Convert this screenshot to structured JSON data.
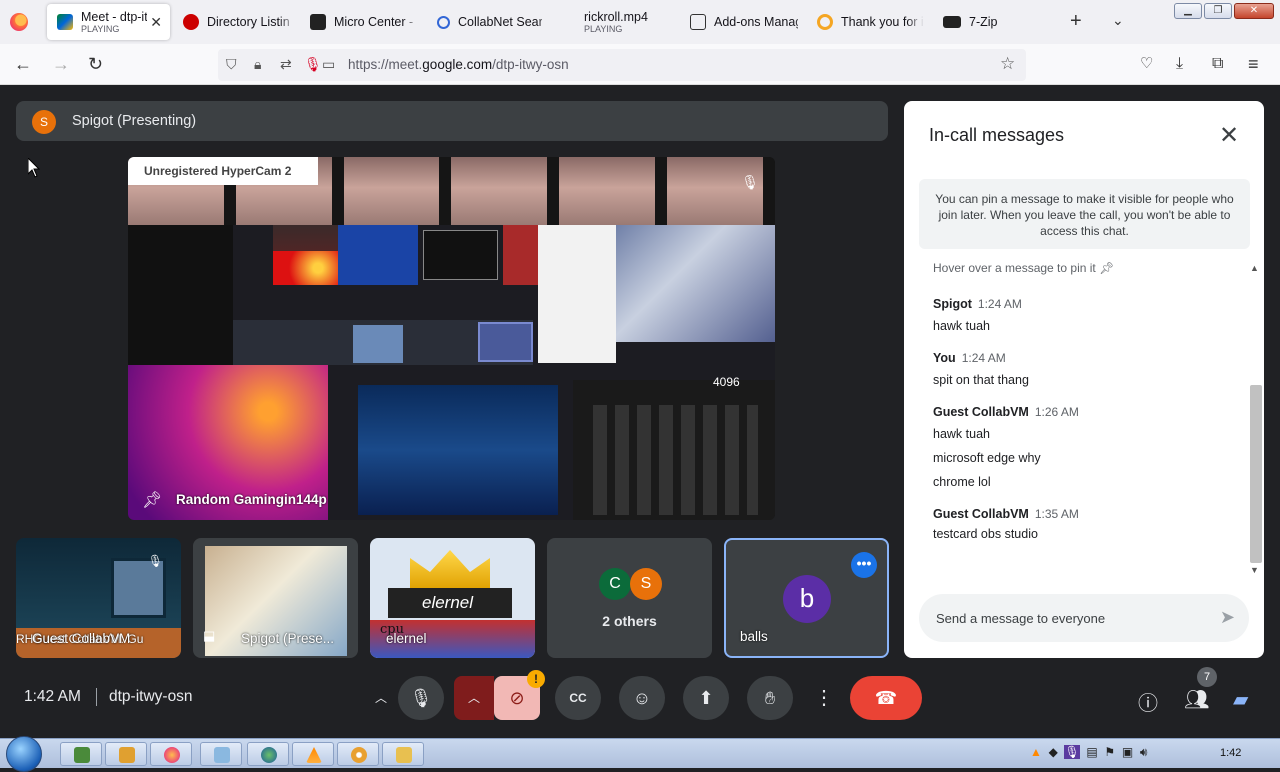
{
  "browser": {
    "tabs": [
      {
        "title": "Meet - dtp-itwy-osn",
        "status": "PLAYING",
        "active": true
      },
      {
        "title": "Directory Listing"
      },
      {
        "title": "Micro Center - I"
      },
      {
        "title": "CollabNet Search"
      },
      {
        "title": "rickroll.mp4",
        "status": "PLAYING"
      },
      {
        "title": "Add-ons Manager"
      },
      {
        "title": "Thank you for i"
      },
      {
        "title": "7-Zip"
      }
    ],
    "url_prefix": "https://meet.",
    "url_domain": "google.com",
    "url_path": "/dtp-itwy-osn"
  },
  "meet": {
    "presenter": {
      "initial": "S",
      "label": "Spigot (Presenting)"
    },
    "main_video": {
      "overlay_label": "Unregistered HyperCam 2",
      "name": "Random Gamingin144p",
      "counter": "4096"
    },
    "participants": [
      {
        "name": "Guest CollabVM",
        "overlay": "RHGuest CollabVM: Gu"
      },
      {
        "name": "Spigot (Prese..."
      },
      {
        "name": "elernel",
        "banner": "elernel",
        "sticker": "cpu"
      },
      {
        "name": "2 others",
        "initials": [
          "C",
          "S"
        ]
      },
      {
        "name": "balls",
        "initial": "b"
      }
    ],
    "bottom": {
      "time": "1:42 AM",
      "meeting_code": "dtp-itwy-osn",
      "people_count": "7",
      "warning": "!"
    }
  },
  "chat": {
    "title": "In-call messages",
    "pin_note": "You can pin a message to make it visible for people who join later. When you leave the call, you won't be able to access this chat.",
    "hover_note": "Hover over a message to pin it",
    "messages": [
      {
        "sender": "Spigot",
        "time": "1:24 AM",
        "lines": [
          "hawk tuah"
        ]
      },
      {
        "sender": "You",
        "time": "1:24 AM",
        "lines": [
          "spit on that thang"
        ]
      },
      {
        "sender": "Guest CollabVM",
        "time": "1:26 AM",
        "lines": [
          "hawk tuah",
          "microsoft edge why",
          "chrome lol"
        ]
      },
      {
        "sender": "Guest CollabVM",
        "time": "1:35 AM",
        "lines": [
          "testcard obs studio"
        ]
      }
    ],
    "input_placeholder": "Send a message to everyone"
  },
  "taskbar": {
    "clock": "1:42"
  },
  "colors": {
    "meet_bg": "#202124",
    "hangup": "#ea4335",
    "accent": "#1a73e8",
    "presenter_avatar": "#e8710a"
  }
}
